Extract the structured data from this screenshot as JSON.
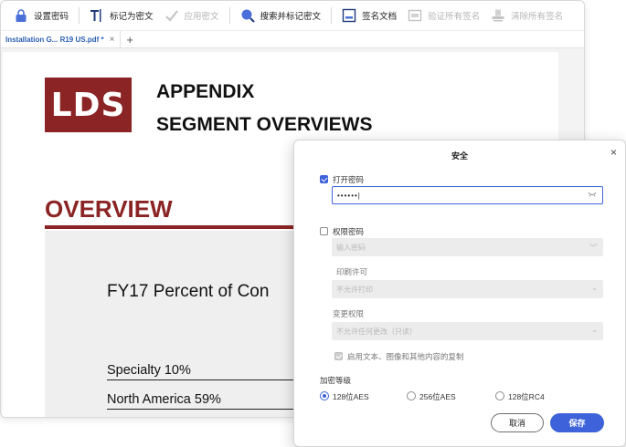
{
  "toolbar": {
    "set_password": "设置密码",
    "mark_redaction": "标记为密文",
    "apply_redaction": "应用密文",
    "search_mark": "搜索并标记密文",
    "sign_document": "签名文档",
    "verify_signatures": "验证所有签名",
    "clear_signatures": "清除所有签名"
  },
  "tabs": [
    {
      "label": "Installation  G... R19 US.pdf *",
      "close": "×"
    }
  ],
  "tab_add": "+",
  "document": {
    "logo_text": "LDS",
    "title": "APPENDIX",
    "subtitle": "SEGMENT OVERVIEWS",
    "overview_heading": "OVERVIEW",
    "chart_title": "FY17 Percent of Con",
    "rows": [
      "Specialty 10%",
      "North America 59%"
    ]
  },
  "dialog": {
    "title": "安全",
    "close": "×",
    "open_password": {
      "label": "打开密码",
      "checked": true,
      "value": "••••••|"
    },
    "permissions_password": {
      "label": "权限密码",
      "checked": false,
      "placeholder": "输入密码"
    },
    "print_permission": {
      "label": "印刷许可",
      "selected": "不允许打印"
    },
    "change_permission": {
      "label": "变更权限",
      "selected": "不允许任何更改（只读）"
    },
    "enable_copy": {
      "label": "启用文本、图像和其他内容的复制",
      "checked": true
    },
    "encryption_level": {
      "label": "加密等级",
      "options": [
        "128位AES",
        "256位AES",
        "128位RC4"
      ],
      "selected": "128位AES"
    },
    "cancel": "取消",
    "save": "保存"
  },
  "colors": {
    "accent": "#3d62d9",
    "brand_red": "#8b2424"
  }
}
